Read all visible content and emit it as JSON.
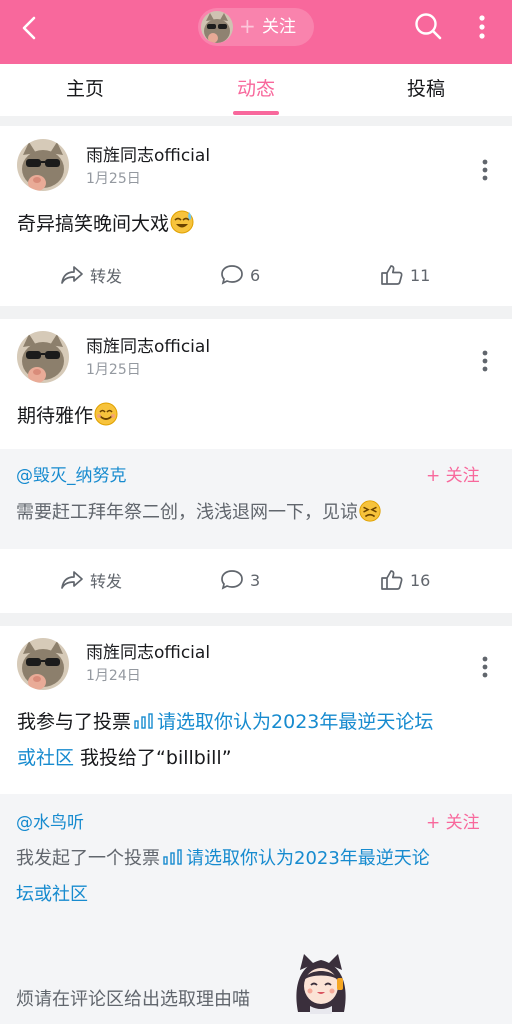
{
  "header": {
    "follow_label": "关注",
    "follow_plus": "+",
    "accent": "#f8689c"
  },
  "tabs": [
    {
      "label": "主页"
    },
    {
      "label": "动态",
      "active": true
    },
    {
      "label": "投稿"
    }
  ],
  "posts": [
    {
      "author": "雨旌同志official",
      "date": "1月25日",
      "text": "奇异搞笑晚间大戏",
      "emoji": "sweat-smile-emoji",
      "actions": {
        "repost": "转发",
        "comments": "6",
        "likes": "11"
      }
    },
    {
      "author": "雨旌同志official",
      "date": "1月25日",
      "text": "期待雅作",
      "emoji": "smile-emoji",
      "quote": {
        "user": "@毁灭_纳努克",
        "follow": "+ 关注",
        "text": "需要赶工拜年祭二创，浅浅退网一下，见谅"
      },
      "actions": {
        "repost": "转发",
        "comments": "3",
        "likes": "16"
      }
    },
    {
      "author": "雨旌同志official",
      "date": "1月24日",
      "text_prefix": "我参与了投票",
      "vote_link_line1": "请选取你认为2023年最逆天论坛",
      "vote_link_line2": "或社区",
      "text_suffix": " 我投给了“billbill”",
      "quote": {
        "user": "@水鸟听",
        "follow": "+ 关注",
        "text_prefix": "我发起了一个投票",
        "vote_link_line1": "请选取你认为2023年最逆天论",
        "vote_link_line2": "坛或社区",
        "text_tail": "烦请在评论区给出选取理由喵"
      }
    }
  ]
}
